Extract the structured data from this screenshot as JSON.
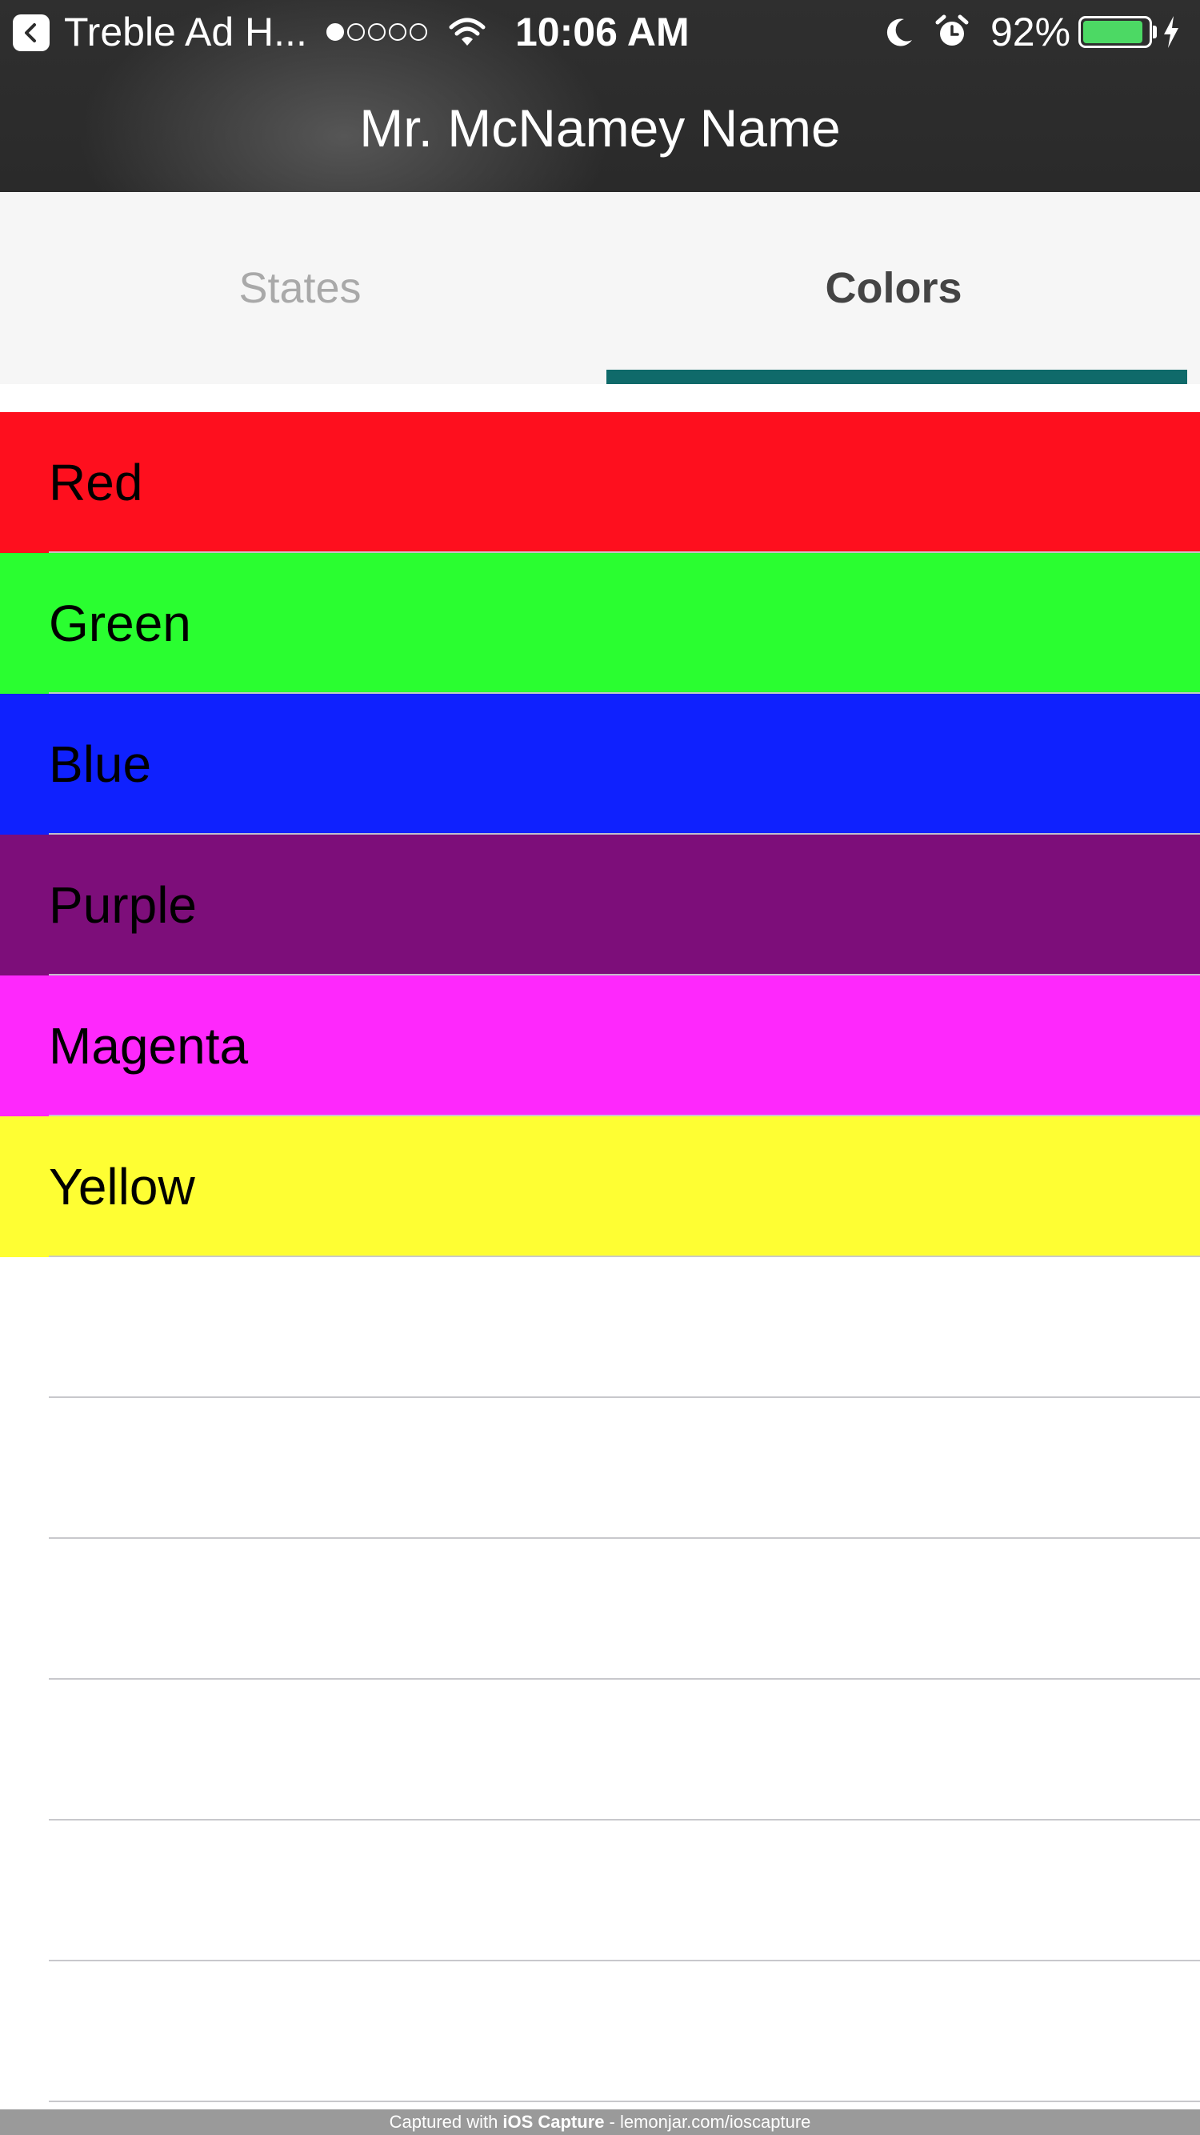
{
  "status_bar": {
    "app_name": "Treble Ad H...",
    "time": "10:06 AM",
    "battery_percent": "92%",
    "battery_level": 0.92,
    "signal_bars_filled": 1,
    "signal_bars_total": 5
  },
  "nav": {
    "title": "Mr. McNamey Name"
  },
  "tabs": [
    {
      "label": "States",
      "selected": false
    },
    {
      "label": "Colors",
      "selected": true
    }
  ],
  "colors": {
    "tab_indicator": "#0f6a6a",
    "header_bg": "#2a2a2a"
  },
  "color_list": [
    {
      "label": "Red",
      "color": "#fe0f1e"
    },
    {
      "label": "Green",
      "color": "#2afe30"
    },
    {
      "label": "Blue",
      "color": "#0f21fe"
    },
    {
      "label": "Purple",
      "color": "#7d0e7a"
    },
    {
      "label": "Magenta",
      "color": "#fe28fc"
    },
    {
      "label": "Yellow",
      "color": "#fefe33"
    }
  ],
  "footer": {
    "prefix": "Captured with",
    "brand": "iOS Capture",
    "suffix": "- lemonjar.com/ioscapture"
  }
}
